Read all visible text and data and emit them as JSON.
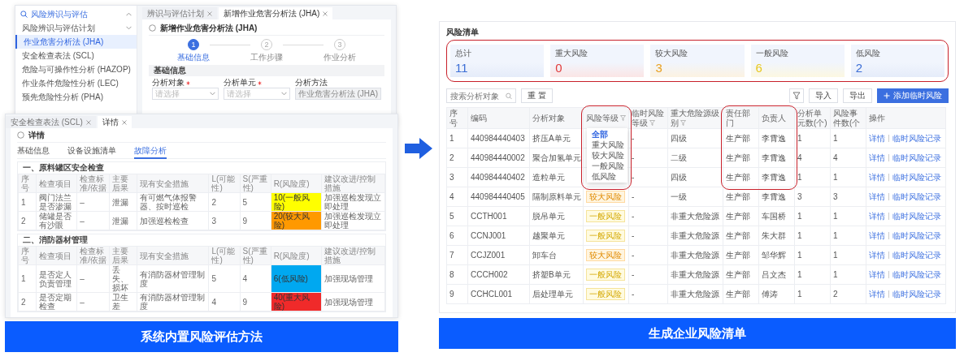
{
  "left_panel": {
    "back_window": {
      "sidebar": {
        "items": [
          {
            "label": "风险辨识与评估",
            "selected": false,
            "expanded": true,
            "children": [
              {
                "label": "风险辨识与评估计划",
                "selected": false,
                "expanded": false
              },
              {
                "label": "作业危害分析法 (JHA)",
                "selected": true
              },
              {
                "label": "安全检查表法 (SCL)",
                "selected": false
              },
              {
                "label": "危险与可操作性分析 (HAZOP)",
                "selected": false
              },
              {
                "label": "作业条件危险性分析 (LEC)",
                "selected": false
              },
              {
                "label": "预先危险性分析 (PHA)",
                "selected": false
              }
            ]
          }
        ]
      },
      "tabs": [
        {
          "label": "辨识与评估计划",
          "selected": false
        },
        {
          "label": "新增作业危害分析法 (JHA)",
          "selected": true
        }
      ],
      "title": "新增作业危害分析法 (JHA)",
      "steps": [
        {
          "number": "1",
          "label": "基础信息",
          "active": true
        },
        {
          "number": "2",
          "label": "工作步骤",
          "active": false
        },
        {
          "number": "3",
          "label": "作业分析",
          "active": false
        }
      ],
      "section_title": "基础信息",
      "fields": [
        {
          "label": "分析对象",
          "required": true,
          "kind": "select",
          "placeholder": "请选择"
        },
        {
          "label": "分析单元",
          "required": true,
          "kind": "select",
          "placeholder": "请选择"
        },
        {
          "label": "分析方法",
          "required": false,
          "kind": "text",
          "value": "作业危害分析法 (JHA)",
          "disabled": true
        }
      ]
    },
    "front_window": {
      "tabs": [
        {
          "label": "安全检查表法 (SCL)",
          "selected": false
        },
        {
          "label": "详情",
          "selected": true
        }
      ],
      "title": "详情",
      "detail_tabs": [
        {
          "label": "基础信息",
          "selected": false
        },
        {
          "label": "设备设施清单",
          "selected": false
        },
        {
          "label": "故障分析",
          "selected": true
        }
      ],
      "sections": [
        {
          "title": "一、原料罐区安全检查",
          "columns": [
            "序号",
            "检查项目",
            "检查标准/依据",
            "主要后果",
            "现有安全措施",
            "L(可能性)",
            "S(严重性)",
            "R(风险度)",
            "建议改进/控制措施"
          ],
          "rows": [
            {
              "cells": [
                "1",
                "阀门法兰是否渗漏",
                "–",
                "泄漏",
                "有可燃气体报警器、按时巡检",
                "2",
                "5",
                "10(一般风险)",
                "加强巡检发现立即处理"
              ],
              "color": "#ffff00"
            },
            {
              "cells": [
                "2",
                "储罐是否有沙眼",
                "–",
                "泄漏",
                "加强巡检检查",
                "3",
                "9",
                "20(较大风险)",
                "加强巡检发现立即处理"
              ],
              "color": "#ff9900"
            }
          ]
        },
        {
          "title": "二、消防器材管理",
          "columns": [
            "序号",
            "检查项目",
            "检查标准/依据",
            "主要后果",
            "现有安全措施",
            "L(可能性)",
            "S(严重性)",
            "R(风险度)",
            "建议改进/控制措施"
          ],
          "rows": [
            {
              "cells": [
                "1",
                "是否定人负责管理",
                "–",
                "丢失、损坏",
                "有消防器材管理制度",
                "5",
                "4",
                "6(低风险)",
                "加强现场管理"
              ],
              "color": "#00a8f0"
            },
            {
              "cells": [
                "2",
                "是否定期检查",
                "–",
                "卫生差",
                "有消防器材管理制度",
                "4",
                "9",
                "40(重大风险)",
                "加强现场管理"
              ],
              "color": "#f02a2a"
            }
          ]
        }
      ]
    },
    "caption": "系统内置风险评估方法"
  },
  "right_panel": {
    "title": "风险清单",
    "summary_cards": [
      {
        "label": "总计",
        "value": "11",
        "color": "#3d6fd6"
      },
      {
        "label": "重大风险",
        "value": "0",
        "color": "#e03c3c"
      },
      {
        "label": "较大风险",
        "value": "3",
        "color": "#e8a020"
      },
      {
        "label": "一般风险",
        "value": "6",
        "color": "#e8c820"
      },
      {
        "label": "低风险",
        "value": "2",
        "color": "#3d6fd6"
      }
    ],
    "search": {
      "placeholder": "搜索分析对象"
    },
    "reset_button": "重 置",
    "actions": [
      "导入",
      "导出"
    ],
    "add_button": "添加临时风险",
    "table": {
      "columns": [
        {
          "label": "序号",
          "filter": false
        },
        {
          "label": "编码",
          "filter": false
        },
        {
          "label": "分析对象",
          "filter": false
        },
        {
          "label": "风险等级",
          "filter": true,
          "menu": {
            "options": [
              {
                "label": "全部",
                "selected": true
              },
              {
                "label": "重大风险",
                "selected": false
              },
              {
                "label": "较大风险",
                "selected": false
              },
              {
                "label": "一般风险",
                "selected": false
              },
              {
                "label": "低风险",
                "selected": false
              }
            ]
          }
        },
        {
          "label": "临时风险等级",
          "filter": true
        },
        {
          "label": "重大危险源级别",
          "filter": true
        },
        {
          "label": "责任部门",
          "filter": false
        },
        {
          "label": "负责人",
          "filter": false
        },
        {
          "label": "分析单元数(个)",
          "filter": false
        },
        {
          "label": "风险事件数(个",
          "filter": false
        },
        {
          "label": "操作",
          "filter": false
        }
      ],
      "rows": [
        {
          "no": "1",
          "code": "440984440403",
          "object": "挤压A单元",
          "temp_risk": "-",
          "hazard_level": "四级",
          "department": "生产部",
          "owner": "李霄逸",
          "units": "1",
          "events": "1",
          "actions": [
            "详情",
            "临时风险记录"
          ]
        },
        {
          "no": "2",
          "code": "440984440002",
          "object": "聚合加氢单元",
          "temp_risk": "-",
          "hazard_level": "二级",
          "department": "生产部",
          "owner": "李霄逸",
          "units": "4",
          "events": "4",
          "actions": [
            "详情",
            "临时风险记录"
          ]
        },
        {
          "no": "3",
          "code": "440984440402",
          "object": "造粒单元",
          "temp_risk": "-",
          "hazard_level": "四级",
          "department": "生产部",
          "owner": "李霄逸",
          "units": "1",
          "events": "1",
          "actions": [
            "详情",
            "临时风险记录"
          ]
        },
        {
          "no": "4",
          "code": "440984440405",
          "object": "隔制原料单元",
          "risk": {
            "label": "较大风险",
            "kind": "moderate"
          },
          "temp_risk": "-",
          "hazard_level": "一级",
          "department": "生产部",
          "owner": "李霄逸",
          "units": "3",
          "events": "3",
          "actions": [
            "详情",
            "临时风险记录"
          ]
        },
        {
          "no": "5",
          "code": "CCTH001",
          "object": "脱吊单元",
          "risk": {
            "label": "一般风险",
            "kind": "general"
          },
          "temp_risk": "-",
          "hazard_level": "非重大危险源",
          "department": "生产部",
          "owner": "车国桥",
          "units": "1",
          "events": "1",
          "actions": [
            "详情",
            "临时风险记录"
          ]
        },
        {
          "no": "6",
          "code": "CCNJ001",
          "object": "越聚单元",
          "risk": {
            "label": "一般风险",
            "kind": "general"
          },
          "temp_risk": "-",
          "hazard_level": "非重大危险源",
          "department": "生产部",
          "owner": "朱大群",
          "units": "1",
          "events": "1",
          "actions": [
            "详情",
            "临时风险记录"
          ]
        },
        {
          "no": "7",
          "code": "CCJZ001",
          "object": "卸车台",
          "risk": {
            "label": "较大风险",
            "kind": "moderate"
          },
          "temp_risk": "-",
          "hazard_level": "非重大危险源",
          "department": "生产部",
          "owner": "邹华辉",
          "units": "1",
          "events": "1",
          "actions": [
            "详情",
            "临时风险记录"
          ]
        },
        {
          "no": "8",
          "code": "CCCH002",
          "object": "挤塑B单元",
          "risk": {
            "label": "一般风险",
            "kind": "general"
          },
          "temp_risk": "-",
          "hazard_level": "非重大危险源",
          "department": "生产部",
          "owner": "吕文杰",
          "units": "1",
          "events": "1",
          "actions": [
            "详情",
            "临时风险记录"
          ]
        },
        {
          "no": "9",
          "code": "CCHCL001",
          "object": "后处理单元",
          "risk": {
            "label": "一般风险",
            "kind": "general"
          },
          "temp_risk": "-",
          "hazard_level": "非重大危险源",
          "department": "生产部",
          "owner": "傅涛",
          "units": "1",
          "events": "2",
          "actions": [
            "详情",
            "临时风险记录"
          ]
        }
      ]
    },
    "caption": "生成企业风险清单"
  }
}
